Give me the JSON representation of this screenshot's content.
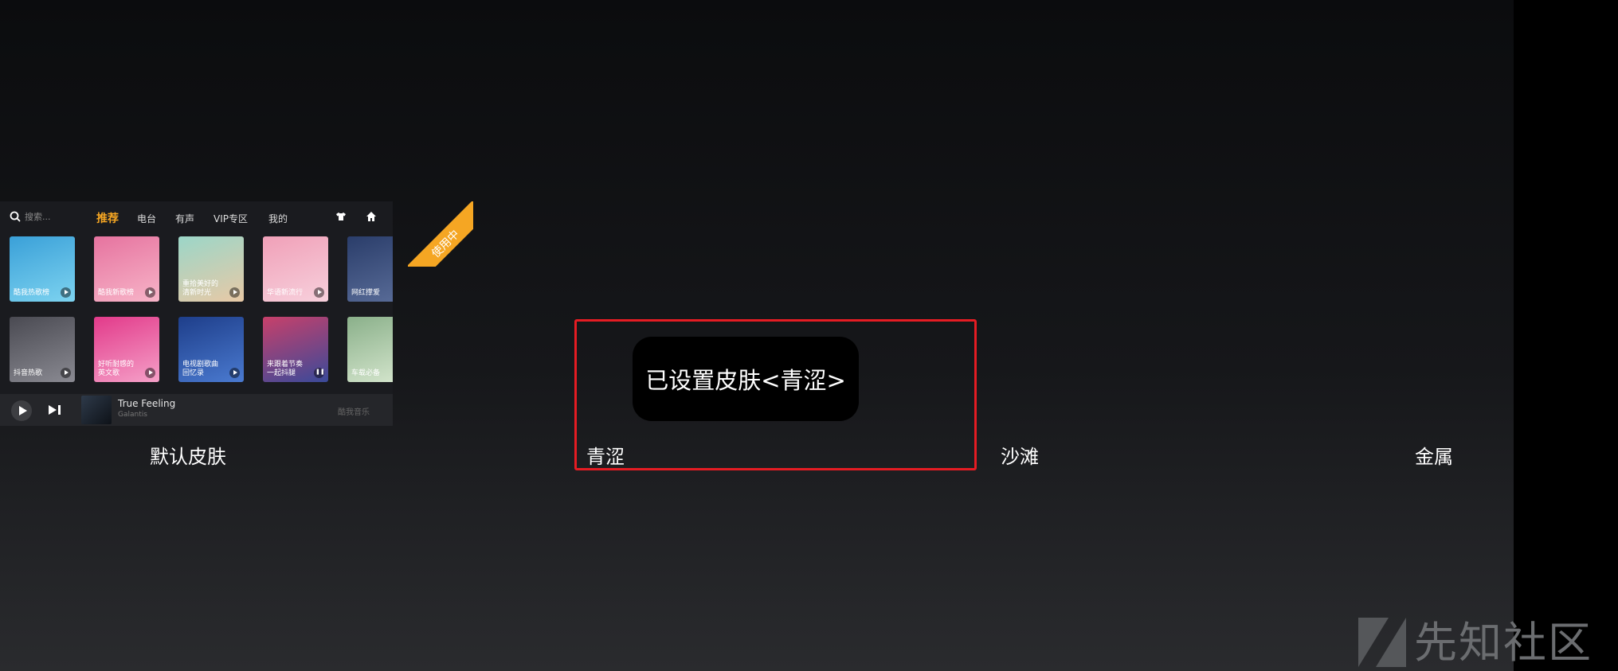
{
  "preview": {
    "search_placeholder": "搜索...",
    "tabs": [
      "推荐",
      "电台",
      "有声",
      "VIP专区",
      "我的"
    ],
    "active_tab": "推荐",
    "tiles_row1": [
      {
        "label": "酷我热歌榜",
        "colors": [
          "#3aa0d8",
          "#7dd3f0"
        ],
        "icon": "play-icon"
      },
      {
        "label": "酷我新歌榜",
        "colors": [
          "#e6739f",
          "#f7b4c8"
        ],
        "icon": "play-icon"
      },
      {
        "label": "重拾美好的\n清新时光",
        "colors": [
          "#9bd6c8",
          "#e8c9a6"
        ],
        "icon": "play-icon"
      },
      {
        "label": "华语新流行",
        "colors": [
          "#f0a0b8",
          "#f7d0dc"
        ],
        "icon": "play-icon"
      },
      {
        "label": "网红撑爱",
        "colors": [
          "#2a3d6a",
          "#5b6e9a"
        ],
        "icon": ""
      }
    ],
    "tiles_row2": [
      {
        "label": "抖音热歌",
        "colors": [
          "#4a4a52",
          "#8a8a92"
        ],
        "icon": "play-icon"
      },
      {
        "label": "好听耐感的\n英文歌",
        "colors": [
          "#e23a8a",
          "#f5a0c8"
        ],
        "icon": "play-icon"
      },
      {
        "label": "电视剧歌曲\n回忆录",
        "colors": [
          "#1e3e8a",
          "#4a7ad0"
        ],
        "icon": "play-icon"
      },
      {
        "label": "来跟着节奏\n一起抖腿",
        "colors": [
          "#c8406a",
          "#3a4a9a"
        ],
        "icon": "pause-icon"
      },
      {
        "label": "车载必备",
        "colors": [
          "#8ab08a",
          "#d8e8d0"
        ],
        "icon": ""
      }
    ],
    "player": {
      "title": "True Feeling",
      "artist": "Galantis",
      "brand": "酷我音乐"
    }
  },
  "ribbon_text": "使用中",
  "skins": [
    "默认皮肤",
    "青涩",
    "沙滩",
    "金属"
  ],
  "toast": "已设置皮肤<青涩>",
  "watermark": "先知社区"
}
